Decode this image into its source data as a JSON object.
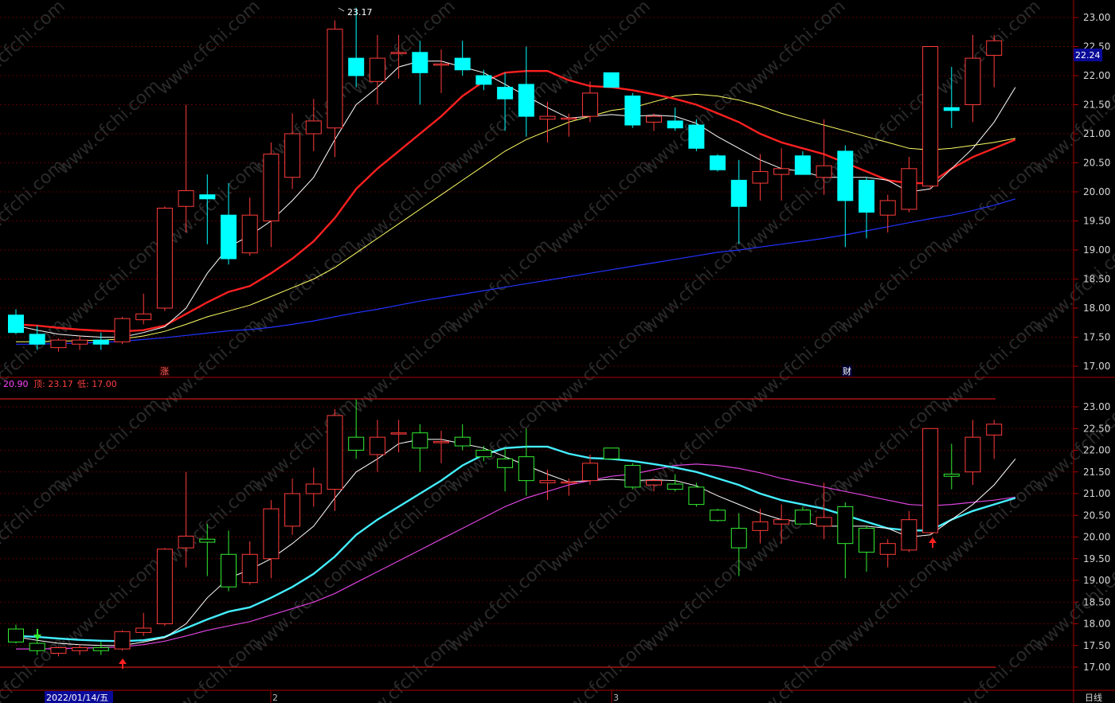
{
  "watermark": "www.cfchi.com",
  "info_bar": {
    "ma_value": "20.90",
    "high_label": "顶: 23.17",
    "low_label": "低: 17.00"
  },
  "top_panel": {
    "peak_label": "23.17",
    "current_price": "22.24",
    "marker_zhang": "涨",
    "marker_cai": "财"
  },
  "bottom_bar": {
    "date_label": "2022/01/14/五",
    "month_2": "2",
    "month_3": "3",
    "period": "日线"
  },
  "colors": {
    "up": "#ff3b3b",
    "down_top": "#00ffff",
    "down_bottom": "#33ee33",
    "ma5": "#ffffff",
    "ma10_top": "#ff2020",
    "ma20_top": "#ffff66",
    "ma60_top": "#2233ff",
    "ma10_bottom": "#44eeff",
    "ma20_bottom": "#dd44dd",
    "grid": "#5a0000"
  },
  "chart_data": [
    {
      "type": "candlestick",
      "panel": "top",
      "ylim": [
        16.85,
        23.25
      ],
      "yticks": [
        "17.00",
        "17.50",
        "18.00",
        "18.50",
        "19.00",
        "19.50",
        "20.00",
        "20.50",
        "21.00",
        "21.50",
        "22.00",
        "22.50",
        "23.00"
      ],
      "candles": [
        {
          "o": 17.88,
          "h": 17.98,
          "l": 17.55,
          "c": 17.58
        },
        {
          "o": 17.55,
          "h": 17.7,
          "l": 17.28,
          "c": 17.38
        },
        {
          "o": 17.32,
          "h": 17.48,
          "l": 17.25,
          "c": 17.45
        },
        {
          "o": 17.38,
          "h": 17.52,
          "l": 17.28,
          "c": 17.45
        },
        {
          "o": 17.45,
          "h": 17.58,
          "l": 17.28,
          "c": 17.38
        },
        {
          "o": 17.42,
          "h": 17.85,
          "l": 17.38,
          "c": 17.82
        },
        {
          "o": 17.8,
          "h": 18.25,
          "l": 17.72,
          "c": 17.9
        },
        {
          "o": 18.0,
          "h": 19.75,
          "l": 17.95,
          "c": 19.72
        },
        {
          "o": 19.75,
          "h": 21.5,
          "l": 19.3,
          "c": 20.02
        },
        {
          "o": 19.95,
          "h": 20.3,
          "l": 19.1,
          "c": 19.88
        },
        {
          "o": 19.6,
          "h": 20.15,
          "l": 18.75,
          "c": 18.85
        },
        {
          "o": 18.95,
          "h": 19.9,
          "l": 18.9,
          "c": 19.6
        },
        {
          "o": 19.5,
          "h": 20.85,
          "l": 19.05,
          "c": 20.65
        },
        {
          "o": 20.25,
          "h": 21.35,
          "l": 20.05,
          "c": 21.0
        },
        {
          "o": 21.0,
          "h": 21.6,
          "l": 20.7,
          "c": 21.22
        },
        {
          "o": 21.1,
          "h": 22.95,
          "l": 20.6,
          "c": 22.8
        },
        {
          "o": 22.3,
          "h": 23.17,
          "l": 21.8,
          "c": 22.0
        },
        {
          "o": 21.9,
          "h": 22.7,
          "l": 21.5,
          "c": 22.3
        },
        {
          "o": 22.4,
          "h": 22.7,
          "l": 21.95,
          "c": 22.4
        },
        {
          "o": 22.4,
          "h": 22.6,
          "l": 21.5,
          "c": 22.05
        },
        {
          "o": 22.2,
          "h": 22.45,
          "l": 21.7,
          "c": 22.2
        },
        {
          "o": 22.3,
          "h": 22.6,
          "l": 22.0,
          "c": 22.1
        },
        {
          "o": 22.0,
          "h": 22.1,
          "l": 21.75,
          "c": 21.85
        },
        {
          "o": 21.8,
          "h": 22.05,
          "l": 21.05,
          "c": 21.6
        },
        {
          "o": 21.85,
          "h": 22.5,
          "l": 20.95,
          "c": 21.3
        },
        {
          "o": 21.25,
          "h": 21.55,
          "l": 20.85,
          "c": 21.3
        },
        {
          "o": 21.27,
          "h": 21.35,
          "l": 20.95,
          "c": 21.27
        },
        {
          "o": 21.3,
          "h": 21.9,
          "l": 21.2,
          "c": 21.7
        },
        {
          "o": 22.05,
          "h": 22.05,
          "l": 21.8,
          "c": 21.8
        },
        {
          "o": 21.65,
          "h": 21.7,
          "l": 21.1,
          "c": 21.15
        },
        {
          "o": 21.2,
          "h": 21.35,
          "l": 21.05,
          "c": 21.3
        },
        {
          "o": 21.22,
          "h": 21.45,
          "l": 21.05,
          "c": 21.1
        },
        {
          "o": 21.15,
          "h": 21.25,
          "l": 20.7,
          "c": 20.75
        },
        {
          "o": 20.62,
          "h": 20.65,
          "l": 20.35,
          "c": 20.38
        },
        {
          "o": 20.2,
          "h": 20.55,
          "l": 19.1,
          "c": 19.75
        },
        {
          "o": 20.15,
          "h": 20.65,
          "l": 19.85,
          "c": 20.35
        },
        {
          "o": 20.3,
          "h": 20.75,
          "l": 19.85,
          "c": 20.4
        },
        {
          "o": 20.62,
          "h": 20.7,
          "l": 20.3,
          "c": 20.3
        },
        {
          "o": 20.25,
          "h": 21.25,
          "l": 19.95,
          "c": 20.45
        },
        {
          "o": 20.7,
          "h": 20.8,
          "l": 19.05,
          "c": 19.85
        },
        {
          "o": 20.2,
          "h": 20.25,
          "l": 19.2,
          "c": 19.65
        },
        {
          "o": 19.6,
          "h": 19.95,
          "l": 19.3,
          "c": 19.85
        },
        {
          "o": 19.7,
          "h": 20.6,
          "l": 19.65,
          "c": 20.4
        },
        {
          "o": 20.1,
          "h": 22.5,
          "l": 20.05,
          "c": 22.5
        },
        {
          "o": 21.45,
          "h": 22.15,
          "l": 21.1,
          "c": 21.4
        },
        {
          "o": 21.5,
          "h": 22.7,
          "l": 21.2,
          "c": 22.3
        },
        {
          "o": 22.35,
          "h": 22.7,
          "l": 21.8,
          "c": 22.6
        }
      ],
      "lines": {
        "ma5": [
          17.7,
          17.62,
          17.55,
          17.52,
          17.5,
          17.5,
          17.58,
          17.68,
          18.0,
          18.6,
          19.05,
          19.25,
          19.5,
          19.85,
          20.25,
          20.9,
          21.5,
          21.8,
          22.15,
          22.25,
          22.25,
          22.15,
          22.05,
          21.85,
          21.65,
          21.45,
          21.27,
          21.3,
          21.33,
          21.3,
          21.32,
          21.3,
          21.18,
          20.95,
          20.75,
          20.55,
          20.4,
          20.35,
          20.25,
          20.25,
          20.25,
          20.2,
          20.0,
          20.05,
          20.4,
          20.75,
          21.2,
          21.8
        ],
        "ma10": [
          17.72,
          17.7,
          17.66,
          17.63,
          17.61,
          17.6,
          17.62,
          17.7,
          17.9,
          18.1,
          18.28,
          18.38,
          18.6,
          18.85,
          19.15,
          19.55,
          20.05,
          20.4,
          20.7,
          21.0,
          21.3,
          21.65,
          21.9,
          22.05,
          22.08,
          22.08,
          21.92,
          21.82,
          21.8,
          21.75,
          21.68,
          21.6,
          21.5,
          21.35,
          21.2,
          21.0,
          20.85,
          20.75,
          20.65,
          20.5,
          20.35,
          20.2,
          20.15,
          20.15,
          20.4,
          20.6,
          20.75,
          20.9
        ],
        "ma20": [
          17.42,
          17.42,
          17.43,
          17.44,
          17.45,
          17.47,
          17.52,
          17.6,
          17.72,
          17.85,
          17.95,
          18.05,
          18.2,
          18.35,
          18.5,
          18.7,
          18.95,
          19.2,
          19.45,
          19.7,
          19.95,
          20.2,
          20.45,
          20.7,
          20.9,
          21.05,
          21.2,
          21.3,
          21.4,
          21.45,
          21.55,
          21.65,
          21.68,
          21.65,
          21.58,
          21.48,
          21.35,
          21.25,
          21.15,
          21.05,
          20.95,
          20.85,
          20.75,
          20.72,
          20.75,
          20.8,
          20.85,
          20.92
        ],
        "ma60": [
          17.38,
          17.38,
          17.39,
          17.4,
          17.41,
          17.43,
          17.46,
          17.49,
          17.53,
          17.57,
          17.61,
          17.63,
          17.67,
          17.72,
          17.78,
          17.85,
          17.92,
          17.98,
          18.05,
          18.12,
          18.18,
          18.24,
          18.3,
          18.36,
          18.42,
          18.48,
          18.54,
          18.6,
          18.66,
          18.72,
          18.78,
          18.84,
          18.9,
          18.96,
          19.0,
          19.05,
          19.1,
          19.15,
          19.2,
          19.26,
          19.33,
          19.4,
          19.47,
          19.54,
          19.6,
          19.68,
          19.77,
          19.88
        ]
      }
    },
    {
      "type": "candlestick",
      "panel": "bottom",
      "ylim": [
        16.85,
        23.25
      ],
      "yticks": [
        "17.00",
        "17.50",
        "18.00",
        "18.50",
        "19.00",
        "19.50",
        "20.00",
        "20.50",
        "21.00",
        "21.50",
        "22.00",
        "22.50",
        "23.00"
      ],
      "reference_lines": [
        23.17,
        17.0
      ],
      "same_candles_as_top": true,
      "lines": {
        "ma5": "same as top ma5",
        "ma10": "same as top ma5 smoothed",
        "ma20": "same as top ma20"
      }
    }
  ]
}
